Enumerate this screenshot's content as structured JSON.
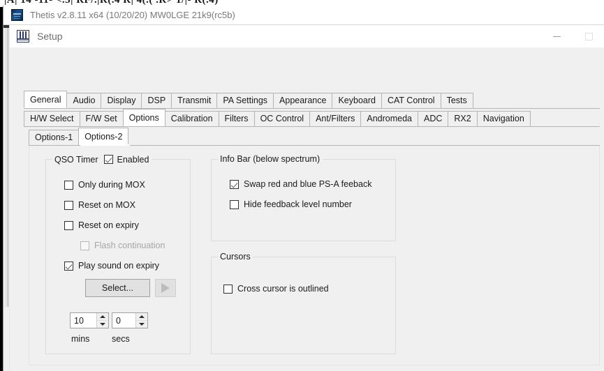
{
  "background_window": {
    "clipped_text": "|A| 14 -11- <.3| RF/.|R(.4 R| 4(.( .R> 1/|- R(.4)"
  },
  "parent_window": {
    "title": "Thetis v2.8.11 x64 (10/20/20) MW0LGE 21k9(rc5b)",
    "icon": "thetis-app-icon"
  },
  "dialog": {
    "title": "Setup",
    "icon": "setup-window-icon",
    "window_controls": [
      {
        "name": "minimize",
        "glyph": "minimize-icon"
      },
      {
        "name": "maximize",
        "glyph": "maximize-icon"
      }
    ]
  },
  "tabs_level1": {
    "selected": "General",
    "items": [
      {
        "label": "General"
      },
      {
        "label": "Audio"
      },
      {
        "label": "Display"
      },
      {
        "label": "DSP"
      },
      {
        "label": "Transmit"
      },
      {
        "label": "PA Settings"
      },
      {
        "label": "Appearance"
      },
      {
        "label": "Keyboard"
      },
      {
        "label": "CAT Control"
      },
      {
        "label": "Tests"
      }
    ]
  },
  "tabs_level2": {
    "selected": "Options",
    "items": [
      {
        "label": "H/W Select"
      },
      {
        "label": "F/W Set"
      },
      {
        "label": "Options"
      },
      {
        "label": "Calibration"
      },
      {
        "label": "Filters"
      },
      {
        "label": "OC Control"
      },
      {
        "label": "Ant/Filters"
      },
      {
        "label": "Andromeda"
      },
      {
        "label": "ADC"
      },
      {
        "label": "RX2"
      },
      {
        "label": "Navigation"
      }
    ]
  },
  "tabs_level3": {
    "selected": "Options-2",
    "items": [
      {
        "label": "Options-1"
      },
      {
        "label": "Options-2"
      }
    ]
  },
  "qso_timer": {
    "title": "QSO Timer",
    "enabled": {
      "label": "Enabled",
      "checked": true,
      "disabled": false
    },
    "checkboxes": [
      {
        "label": "Only during MOX",
        "checked": false,
        "disabled": false
      },
      {
        "label": "Reset on MOX",
        "checked": false,
        "disabled": false
      },
      {
        "label": "Reset on expiry",
        "checked": false,
        "disabled": false
      },
      {
        "label": "Flash continuation",
        "checked": false,
        "disabled": true
      },
      {
        "label": "Play sound on expiry",
        "checked": true,
        "disabled": false
      }
    ],
    "select_button": "Select...",
    "play_button": "play-icon",
    "mins": {
      "value": "10",
      "label": "mins"
    },
    "secs": {
      "value": "0",
      "label": "secs"
    }
  },
  "info_bar": {
    "title": "Info Bar (below spectrum)",
    "checkboxes": [
      {
        "label": "Swap red and blue PS-A feeback",
        "checked": true
      },
      {
        "label": "Hide feedback level number",
        "checked": false
      }
    ]
  },
  "cursors": {
    "title": "Cursors",
    "checkboxes": [
      {
        "label": "Cross cursor is outlined",
        "checked": false
      }
    ]
  },
  "colors": {
    "dialog_background": "#F0F0F0",
    "titlebar_background": "#FFFFFF",
    "selected_tab_background": "#FFFFFF",
    "tab_border": "#B4B4B4",
    "groupbox_border": "#DCDCDC",
    "text": "#1A1A1A",
    "title_text": "#6E6E6E",
    "disabled_text": "#A6A6A6",
    "button_face": "#E1E1E1"
  }
}
